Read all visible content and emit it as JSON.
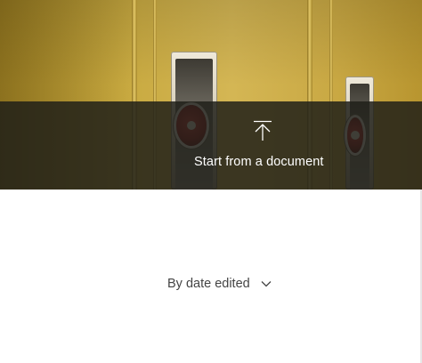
{
  "header": {
    "start_from_document_label": "Start from a document",
    "upload_icon": "upload-arrow-icon"
  },
  "sort": {
    "label": "By date edited",
    "icon": "chevron-down-icon"
  },
  "colors": {
    "overlay": "#1e1e18",
    "locker_yellow": "#d4b654",
    "label_text": "#444444"
  }
}
